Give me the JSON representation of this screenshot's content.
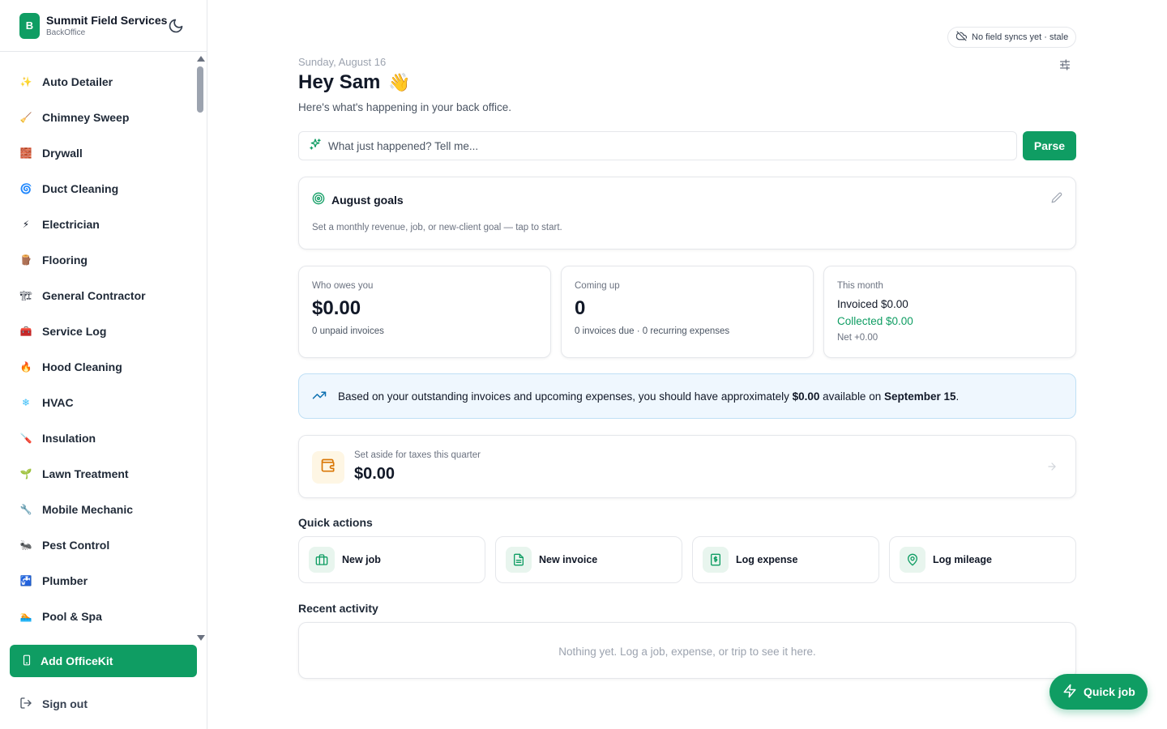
{
  "brand": {
    "initial": "B",
    "name": "Summit Field Services",
    "subtitle": "BackOffice"
  },
  "sidebar": {
    "items": [
      {
        "label": "Auto Detailer",
        "icon": "✨"
      },
      {
        "label": "Chimney Sweep",
        "icon": "🧹"
      },
      {
        "label": "Drywall",
        "icon": "🧱"
      },
      {
        "label": "Duct Cleaning",
        "icon": "🌀"
      },
      {
        "label": "Electrician",
        "icon": "⚡"
      },
      {
        "label": "Flooring",
        "icon": "🪵"
      },
      {
        "label": "General Contractor",
        "icon": "🏗"
      },
      {
        "label": "Service Log",
        "icon": "🧰"
      },
      {
        "label": "Hood Cleaning",
        "icon": "🔥"
      },
      {
        "label": "HVAC",
        "icon": "❄"
      },
      {
        "label": "Insulation",
        "icon": "🪛"
      },
      {
        "label": "Lawn Treatment",
        "icon": "🌱"
      },
      {
        "label": "Mobile Mechanic",
        "icon": "🔧"
      },
      {
        "label": "Pest Control",
        "icon": "🐜"
      },
      {
        "label": "Plumber",
        "icon": "🚰"
      },
      {
        "label": "Pool & Spa",
        "icon": "🏊"
      }
    ],
    "add_button": "Add OfficeKit",
    "signout": "Sign out"
  },
  "header": {
    "sync_status": "No field syncs yet · stale",
    "date": "Sunday, August 16",
    "greeting": "Hey Sam",
    "greeting_emoji": "👋",
    "subtitle": "Here's what's happening in your back office."
  },
  "ask": {
    "placeholder": "What just happened? Tell me...",
    "button": "Parse"
  },
  "goals": {
    "title": "August goals",
    "hint": "Set a monthly revenue, job, or new-client goal — tap to start."
  },
  "stats": {
    "owes": {
      "label": "Who owes you",
      "value": "$0.00",
      "sub": "0 unpaid invoices"
    },
    "coming": {
      "label": "Coming up",
      "value": "0",
      "sub": "0 invoices due · 0 recurring expenses"
    },
    "month": {
      "label": "This month",
      "invoiced": "Invoiced $0.00",
      "collected": "Collected $0.00",
      "net": "Net +0.00"
    }
  },
  "forecast": {
    "prefix": "Based on your outstanding invoices and upcoming expenses, you should have approximately ",
    "amount": "$0.00",
    "middle": " available on ",
    "date": "September 15",
    "suffix": "."
  },
  "taxes": {
    "label": "Set aside for taxes this quarter",
    "value": "$0.00"
  },
  "quick_actions": {
    "title": "Quick actions",
    "new_job": "New job",
    "new_invoice": "New invoice",
    "log_expense": "Log expense",
    "log_mileage": "Log mileage"
  },
  "recent": {
    "title": "Recent activity",
    "empty": "Nothing yet. Log a job, expense, or trip to see it here."
  },
  "fab": {
    "label": "Quick job"
  },
  "colors": {
    "accent": "#0f9d63",
    "forecast_bg": "#eff7fe",
    "tax_bg": "#fef6e4"
  }
}
